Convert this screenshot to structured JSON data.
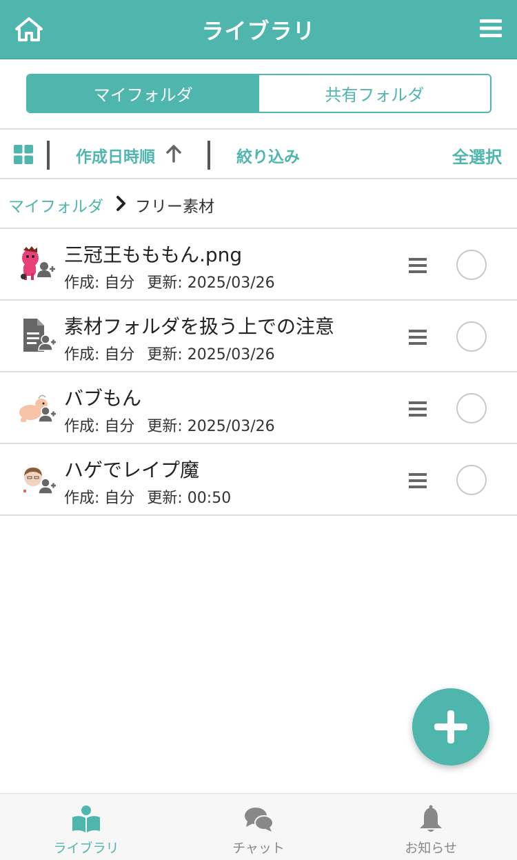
{
  "header": {
    "title": "ライブラリ"
  },
  "segment": {
    "my_folder": "マイフォルダ",
    "shared_folder": "共有フォルダ"
  },
  "toolbar": {
    "sort_label": "作成日時順",
    "filter_label": "絞り込み",
    "select_all_label": "全選択"
  },
  "breadcrumb": {
    "root": "マイフォルダ",
    "current": "フリー素材"
  },
  "items": [
    {
      "name": "三冠王もももん.png",
      "creator": "作成: 自分",
      "updated": "更新: 2025/03/26",
      "thumb": "pink-character-thumbnail"
    },
    {
      "name": "素材フォルダを扱う上での注意",
      "creator": "作成: 自分",
      "updated": "更新: 2025/03/26",
      "thumb": "document-icon"
    },
    {
      "name": "バブもん",
      "creator": "作成: 自分",
      "updated": "更新: 2025/03/26",
      "thumb": "baby-character-thumbnail"
    },
    {
      "name": "ハゲでレイプ魔",
      "creator": "作成: 自分",
      "updated": "更新: 00:50",
      "thumb": "face-character-thumbnail"
    }
  ],
  "tabs": {
    "library": "ライブラリ",
    "chat": "チャット",
    "notifications": "お知らせ"
  },
  "colors": {
    "accent": "#4fb6ad",
    "icon_gray": "#666666",
    "tab_inactive": "#888888"
  }
}
